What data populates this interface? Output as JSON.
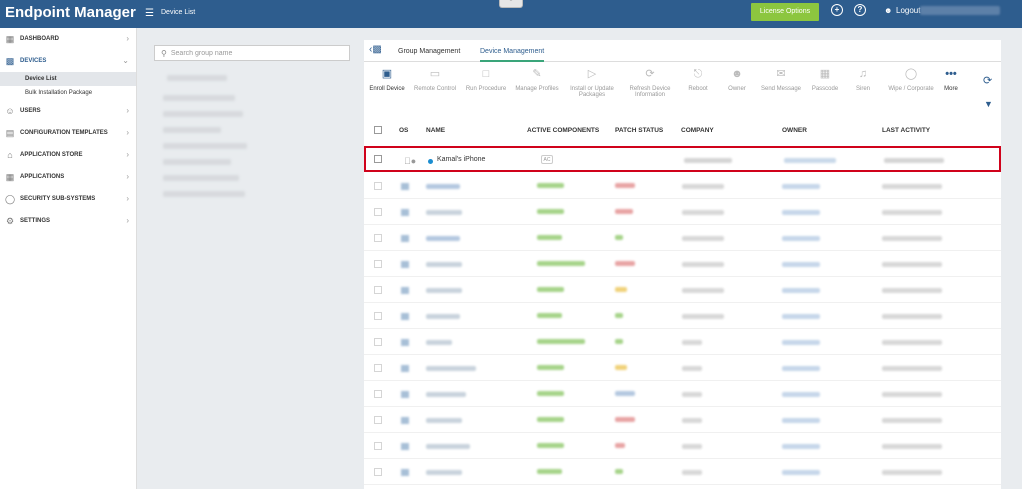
{
  "app": {
    "title": "Endpoint Manager",
    "breadcrumb": "Device List"
  },
  "header": {
    "license_label": "License Options",
    "logout_label": "Logout",
    "collapse_icon": "chevron-up-icon"
  },
  "sidebar": {
    "items": [
      {
        "label": "DASHBOARD",
        "icon": "dashboard-icon"
      },
      {
        "label": "DEVICES",
        "icon": "devices-icon",
        "expanded": true,
        "children": [
          {
            "label": "Device List",
            "selected": true
          },
          {
            "label": "Bulk Installation Package"
          }
        ]
      },
      {
        "label": "USERS",
        "icon": "user-icon"
      },
      {
        "label": "CONFIGURATION TEMPLATES",
        "icon": "template-icon"
      },
      {
        "label": "APPLICATION STORE",
        "icon": "store-icon"
      },
      {
        "label": "APPLICATIONS",
        "icon": "applications-icon"
      },
      {
        "label": "SECURITY SUB-SYSTEMS",
        "icon": "shield-icon"
      },
      {
        "label": "SETTINGS",
        "icon": "gear-icon"
      }
    ]
  },
  "groups": {
    "search_placeholder": "Search group name"
  },
  "tabs": [
    {
      "label": "Group Management"
    },
    {
      "label": "Device Management",
      "active": true
    }
  ],
  "toolbar": [
    {
      "label": "Enroll Device",
      "icon": "enroll-device-icon",
      "enabled": true
    },
    {
      "label": "Remote Control",
      "icon": "remote-control-icon",
      "enabled": false
    },
    {
      "label": "Run Procedure",
      "icon": "run-procedure-icon",
      "enabled": false
    },
    {
      "label": "Manage Profiles",
      "icon": "manage-profiles-icon",
      "enabled": false
    },
    {
      "label": "Install or Update Packages",
      "icon": "install-packages-icon",
      "enabled": false
    },
    {
      "label": "Refresh Device Information",
      "icon": "refresh-device-icon",
      "enabled": false
    },
    {
      "label": "Reboot",
      "icon": "reboot-icon",
      "enabled": false
    },
    {
      "label": "Owner",
      "icon": "owner-icon",
      "enabled": false
    },
    {
      "label": "Send Message",
      "icon": "message-icon",
      "enabled": false
    },
    {
      "label": "Passcode",
      "icon": "passcode-icon",
      "enabled": false
    },
    {
      "label": "Siren",
      "icon": "siren-icon",
      "enabled": false
    },
    {
      "label": "Wipe / Corporate",
      "icon": "wipe-icon",
      "enabled": false
    },
    {
      "label": "More",
      "icon": "more-icon",
      "enabled": true
    }
  ],
  "table": {
    "columns": [
      "OS",
      "NAME",
      "ACTIVE COMPONENTS",
      "PATCH STATUS",
      "COMPANY",
      "OWNER",
      "LAST ACTIVITY"
    ],
    "highlighted_row": {
      "os": "apple-icon",
      "name": "Kamal's iPhone",
      "active_components": "AC"
    }
  },
  "colors": {
    "topbar": "#2e5d8e",
    "license": "#8cc63f",
    "highlight": "#d0021b",
    "tab_active": "#3aa57a"
  }
}
